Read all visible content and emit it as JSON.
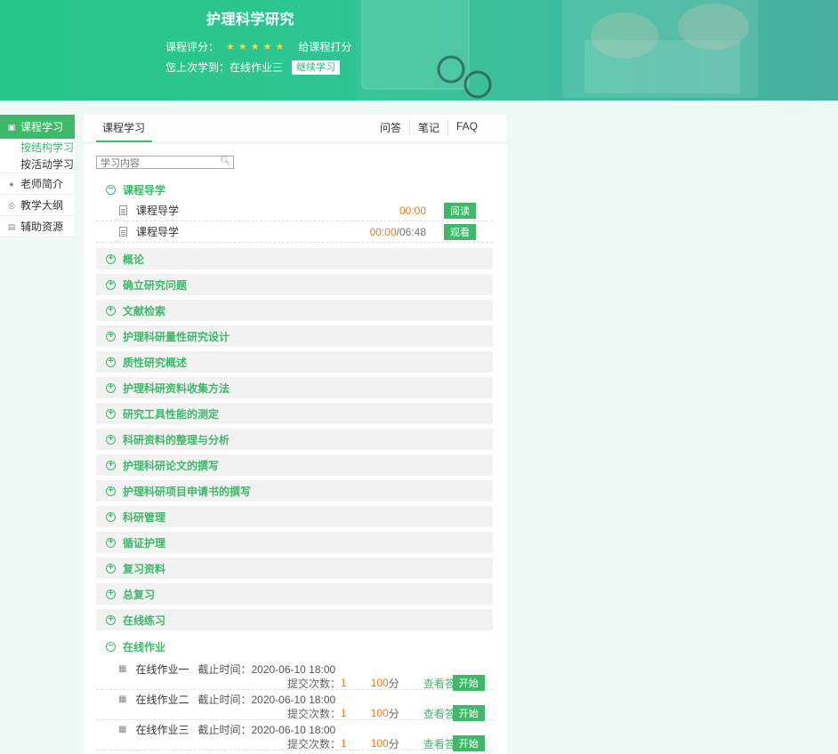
{
  "header": {
    "title": "护理科学研究",
    "rating_label": "课程评分：",
    "stars": "★★★★★",
    "rate_link": "给课程打分",
    "last_label": "您上次学到：在线作业三",
    "continue_label": "继续学习"
  },
  "sidebar": {
    "items": [
      {
        "label": "课程学习",
        "icon": "book-icon"
      },
      {
        "label": "老师简介",
        "icon": "person-icon"
      },
      {
        "label": "教学大纲",
        "icon": "outline-icon"
      },
      {
        "label": "辅助资源",
        "icon": "resource-icon"
      }
    ],
    "subs": [
      {
        "label": "按结构学习"
      },
      {
        "label": "按活动学习"
      }
    ]
  },
  "tabs": {
    "main": "课程学习",
    "links": [
      "问答",
      "笔记",
      "FAQ"
    ]
  },
  "search": {
    "placeholder": "学习内容"
  },
  "chapters": [
    "课程导学",
    "概论",
    "确立研究问题",
    "文献检索",
    "护理科研量性研究设计",
    "质性研究概述",
    "护理科研资料收集方法",
    "研究工具性能的测定",
    "科研资料的整理与分析",
    "护理科研论文的撰写",
    "护理科研项目申请书的撰写",
    "科研管理",
    "循证护理",
    "复习资料",
    "总复习",
    "在线练习",
    "在线作业"
  ],
  "lessons": [
    {
      "name": "课程导学",
      "time": "00:00",
      "total": "",
      "action": "阅读"
    },
    {
      "name": "课程导学",
      "time": "00:00",
      "total": "/06:48",
      "action": "观看"
    }
  ],
  "homework": [
    {
      "name": "在线作业一",
      "due": "截止时间：2020-06-10 18:00",
      "count_label": "提交次数：",
      "count": "1",
      "score": "100",
      "unit": "分",
      "view": "查看答案",
      "start": "开始"
    },
    {
      "name": "在线作业二",
      "due": "截止时间：2020-06-10 18:00",
      "count_label": "提交次数：",
      "count": "1",
      "score": "100",
      "unit": "分",
      "view": "查看答案",
      "start": "开始"
    },
    {
      "name": "在线作业三",
      "due": "截止时间：2020-06-10 18:00",
      "count_label": "提交次数：",
      "count": "1",
      "score": "100",
      "unit": "分",
      "view": "查看答案",
      "start": "开始"
    }
  ],
  "colors": {
    "accent": "#3fb86a",
    "orange": "#f07a1e",
    "banner": "#2ec592"
  }
}
